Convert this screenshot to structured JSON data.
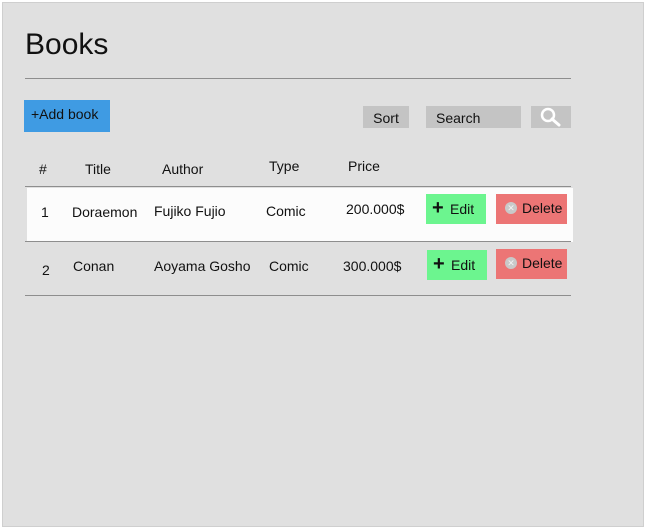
{
  "page": {
    "title": "Books"
  },
  "toolbar": {
    "add_label": "+Add book",
    "sort_label": "Sort",
    "search_placeholder": "Search",
    "search_icon": "magnifier-icon"
  },
  "table": {
    "headers": {
      "num": "#",
      "title": "Title",
      "author": "Author",
      "type": "Type",
      "price": "Price"
    },
    "rows": [
      {
        "num": "1",
        "title": "Doraemon",
        "author": "Fujiko Fujio",
        "type": "Comic",
        "price": "200.000$",
        "edit": "Edit",
        "delete": "Delete"
      },
      {
        "num": "2",
        "title": "Conan",
        "author": "Aoyama Gosho",
        "type": "Comic",
        "price": "300.000$",
        "edit": "Edit",
        "delete": "Delete"
      }
    ]
  },
  "colors": {
    "background": "#e0e0e0",
    "add_button": "#3f9be3",
    "edit_button": "#6cf58f",
    "delete_button": "#ec7575",
    "neutral_button": "#c4c4c4"
  }
}
